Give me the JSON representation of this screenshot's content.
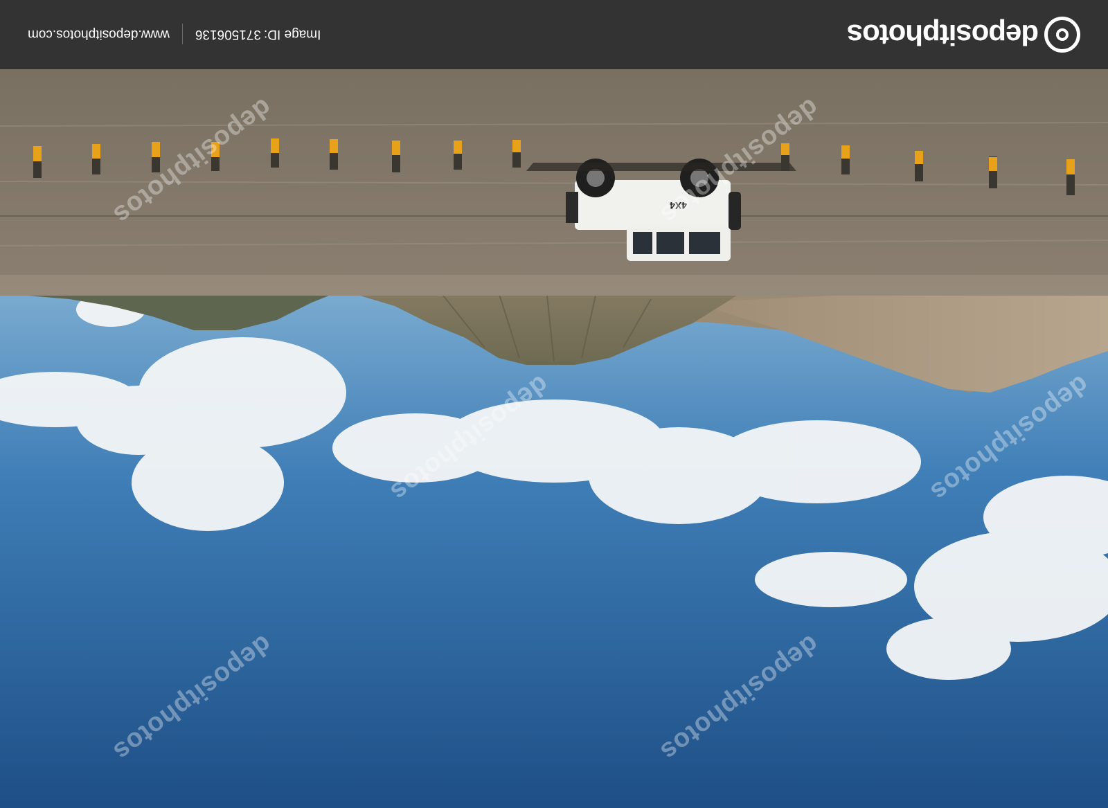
{
  "brand": {
    "name": "depositphotos",
    "logo_icon": "depositphotos-logo-icon"
  },
  "meta": {
    "image_id_label": "Image ID:",
    "image_id_value": "371506136",
    "website": "www.depositphotos.com"
  },
  "photo": {
    "vehicle_marking": "4X4",
    "watermark_text": "depositphotos",
    "orientation": "upside-down"
  },
  "colors": {
    "bar_background": "#333333",
    "sky_top": "#1e4f86",
    "sky_bottom": "#a8cde0",
    "road": "#847a6c",
    "post_yellow": "#e7a21a"
  }
}
